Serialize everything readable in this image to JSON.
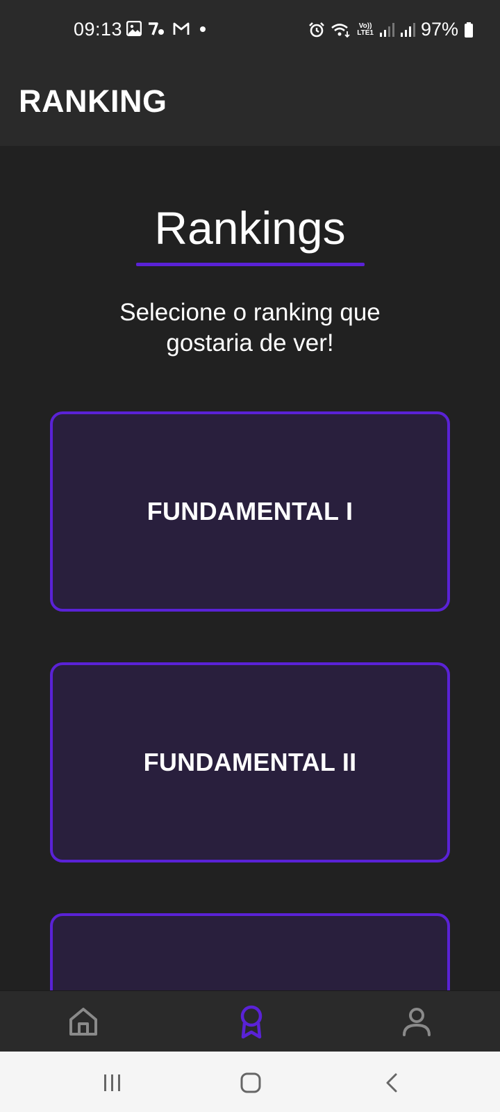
{
  "status_bar": {
    "time": "09:13",
    "battery": "97%",
    "lte_top": "Vo))",
    "lte_bottom": "LTE1",
    "left_icons": [
      "image-icon",
      "tinder-like-icon",
      "gmail-icon",
      "dot-icon"
    ],
    "right_icons": [
      "alarm-icon",
      "wifi-icon",
      "volte-icon",
      "signal-icon",
      "signal-icon",
      "battery-icon"
    ]
  },
  "app_bar": {
    "title": "RANKING"
  },
  "main": {
    "heading": "Rankings",
    "subtitle": "Selecione o ranking que gostaria de ver!",
    "cards": [
      {
        "label": "FUNDAMENTAL I"
      },
      {
        "label": "FUNDAMENTAL II"
      },
      {
        "label": ""
      }
    ]
  },
  "bottom_nav": {
    "items": [
      {
        "icon": "home-icon",
        "active": false
      },
      {
        "icon": "ribbon-award-icon",
        "active": true
      },
      {
        "icon": "user-icon",
        "active": false
      }
    ]
  },
  "colors": {
    "accent": "#5a22d6",
    "card_bg": "#291f3d",
    "background": "#212121",
    "bar_bg": "#2a2a2a",
    "inactive_icon": "#8a8a8a"
  }
}
